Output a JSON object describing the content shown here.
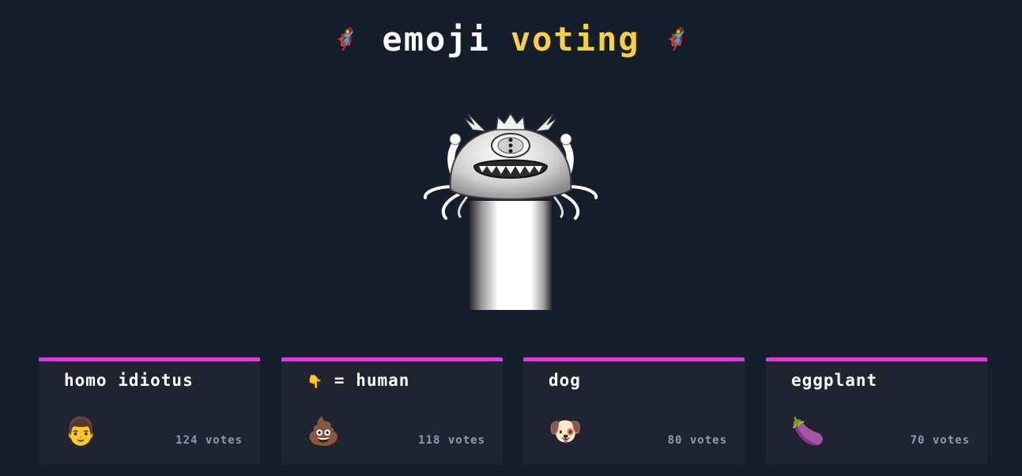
{
  "header": {
    "title_word1": "emoji",
    "title_word2": "voting",
    "left_emoji": "🦸",
    "right_emoji": "🦸"
  },
  "hero": {
    "icon": "crowned-cyclops-monster-illustration"
  },
  "candidates": [
    {
      "title_emoji": "",
      "title": "homo idiotus",
      "emoji": "👨",
      "votes": "124 votes"
    },
    {
      "title_emoji": "👇",
      "title": "= human",
      "emoji": "💩",
      "votes": "118 votes"
    },
    {
      "title_emoji": "",
      "title": "dog",
      "emoji": "🐶",
      "votes": "80 votes"
    },
    {
      "title_emoji": "",
      "title": "eggplant",
      "emoji": "🍆",
      "votes": "70 votes"
    }
  ],
  "colors": {
    "background": "#161e2b",
    "card_background": "#1f2430",
    "card_accent": "#d43fe3",
    "title_highlight": "#f7d23e",
    "votes_text": "#8f99b5"
  }
}
